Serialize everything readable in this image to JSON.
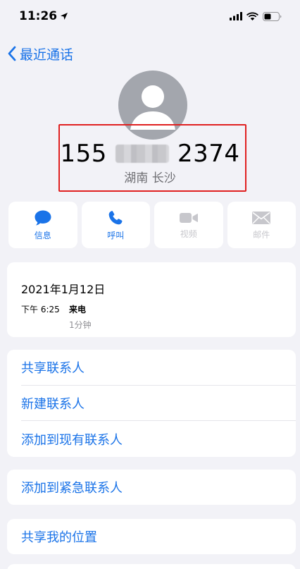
{
  "status_bar": {
    "time": "11:26"
  },
  "nav": {
    "back_label": "最近通话"
  },
  "contact": {
    "number_prefix": "155",
    "number_suffix": "2374",
    "location": "湖南 长沙"
  },
  "actions": [
    {
      "label": "信息",
      "icon": "message-icon",
      "enabled": true
    },
    {
      "label": "呼叫",
      "icon": "phone-icon",
      "enabled": true
    },
    {
      "label": "视频",
      "icon": "video-icon",
      "enabled": false
    },
    {
      "label": "邮件",
      "icon": "mail-icon",
      "enabled": false
    }
  ],
  "call_log": {
    "date": "2021年1月12日",
    "time": "下午 6:25",
    "type": "来电",
    "duration": "1分钟"
  },
  "options": [
    "共享联系人",
    "新建联系人",
    "添加到现有联系人"
  ],
  "emergency": "添加到紧急联系人",
  "share_location": "共享我的位置",
  "colors": {
    "accent": "#1a73e8",
    "highlight_border": "#e02020",
    "background": "#f2f2f7"
  }
}
